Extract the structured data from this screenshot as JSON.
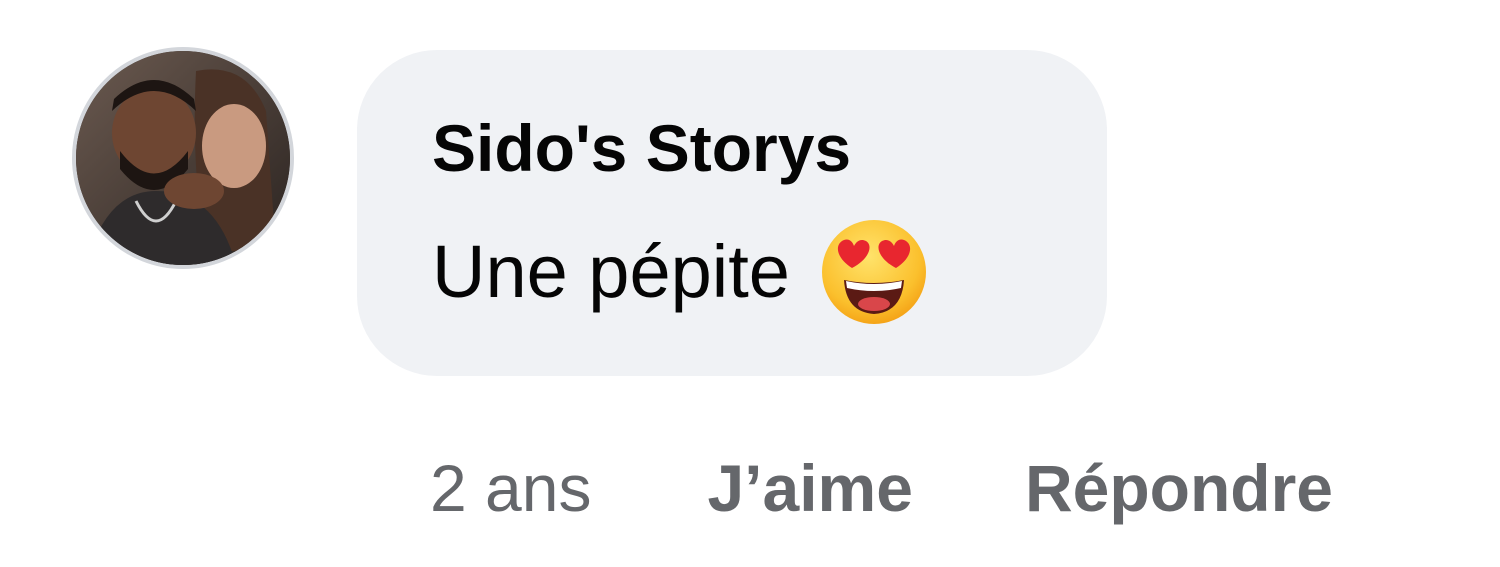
{
  "comment": {
    "author": "Sido's Storys",
    "text": "Une pépite",
    "emoji": "smiling-face-with-heart-eyes"
  },
  "actions": {
    "time": "2 ans",
    "like_label": "J’aime",
    "reply_label": "Répondre"
  },
  "colors": {
    "bubble_bg": "#f0f2f5",
    "author_text": "#050505",
    "secondary_text": "#65676b",
    "avatar_border": "#d3d6db"
  }
}
